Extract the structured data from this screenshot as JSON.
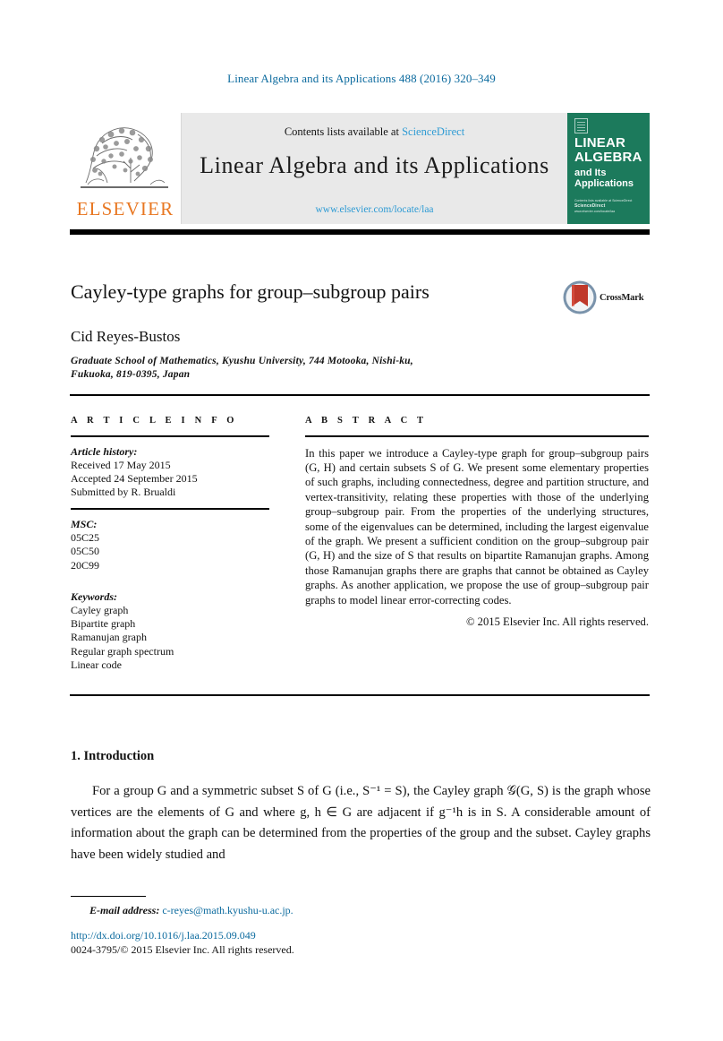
{
  "running_head": "Linear Algebra and its Applications 488 (2016) 320–349",
  "masthead": {
    "publisher_name": "ELSEVIER",
    "contents_prefix": "Contents lists available at",
    "contents_link": "ScienceDirect",
    "journal_title": "Linear Algebra and its Applications",
    "journal_url": "www.elsevier.com/locate/laa",
    "cover": {
      "line1": "LINEAR",
      "line2": "ALGEBRA",
      "line3": "and Its",
      "line4": "Applications",
      "foot1": "Contents lists available at ScienceDirect",
      "foot2": "ScienceDirect",
      "foot3": "www.elsevier.com/locate/laa",
      "background_color": "#1c7a5c"
    }
  },
  "article": {
    "title": "Cayley-type graphs for group–subgroup pairs",
    "author": "Cid Reyes-Bustos",
    "affiliation_line1": "Graduate School of Mathematics, Kyushu University, 744 Motooka, Nishi-ku,",
    "affiliation_line2": "Fukuoka, 819-0395, Japan",
    "crossmark_label": "CrossMark"
  },
  "info": {
    "heading": "A R T I C L E   I N F O",
    "history_label": "Article history:",
    "history": [
      "Received 17 May 2015",
      "Accepted 24 September 2015",
      "Submitted by R. Brualdi"
    ],
    "msc_label": "MSC:",
    "msc": [
      "05C25",
      "05C50",
      "20C99"
    ],
    "keywords_label": "Keywords:",
    "keywords": [
      "Cayley graph",
      "Bipartite graph",
      "Ramanujan graph",
      "Regular graph spectrum",
      "Linear code"
    ]
  },
  "abstract": {
    "heading": "A B S T R A C T",
    "text": "In this paper we introduce a Cayley-type graph for group–subgroup pairs (G, H) and certain subsets S of G. We present some elementary properties of such graphs, including connectedness, degree and partition structure, and vertex-transitivity, relating these properties with those of the underlying group–subgroup pair. From the properties of the underlying structures, some of the eigenvalues can be determined, including the largest eigenvalue of the graph. We present a sufficient condition on the group–subgroup pair (G, H) and the size of S that results on bipartite Ramanujan graphs. Among those Ramanujan graphs there are graphs that cannot be obtained as Cayley graphs. As another application, we propose the use of group–subgroup pair graphs to model linear error-correcting codes.",
    "copyright": "© 2015 Elsevier Inc. All rights reserved."
  },
  "body": {
    "section_number_title": "1.  Introduction",
    "paragraph": "For a group G and a symmetric subset S of G (i.e., S⁻¹ = S), the Cayley graph 𝒢(G, S) is the graph whose vertices are the elements of G and where g, h ∈ G are adjacent if g⁻¹h is in S. A considerable amount of information about the graph can be determined from the properties of the group and the subset. Cayley graphs have been widely studied and"
  },
  "footer": {
    "email_label": "E-mail address:",
    "email": "c-reyes@math.kyushu-u.ac.jp.",
    "doi": "http://dx.doi.org/10.1016/j.laa.2015.09.049",
    "issn_copyright": "0024-3795/© 2015 Elsevier Inc. All rights reserved."
  },
  "colors": {
    "link_blue": "#0b6a9e",
    "sciencedirect_blue": "#2e9bd4",
    "elsevier_orange": "#e87722",
    "cover_green": "#1c7a5c"
  }
}
